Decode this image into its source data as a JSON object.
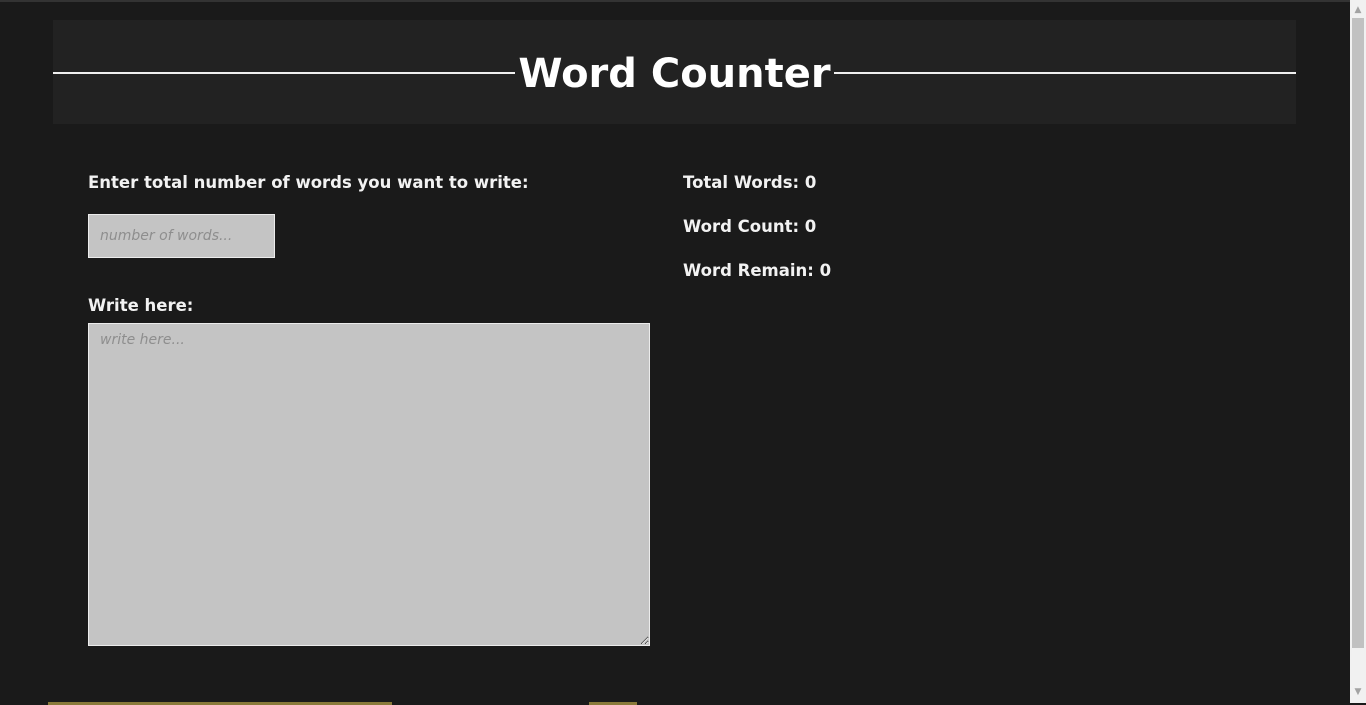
{
  "header": {
    "title": "Word Counter"
  },
  "form": {
    "target_label": "Enter total number of words you want to write:",
    "target_placeholder": "number of words...",
    "target_value": "",
    "write_label": "Write here:",
    "write_placeholder": "write here...",
    "write_value": ""
  },
  "stats": {
    "total_words": "Total Words: 0",
    "word_count": "Word Count: 0",
    "word_remain": "Word Remain: 0"
  },
  "colors": {
    "background": "#1a1a1a",
    "header_background": "#222222",
    "field_background": "#c4c4c4",
    "text": "#f2f2f2"
  }
}
